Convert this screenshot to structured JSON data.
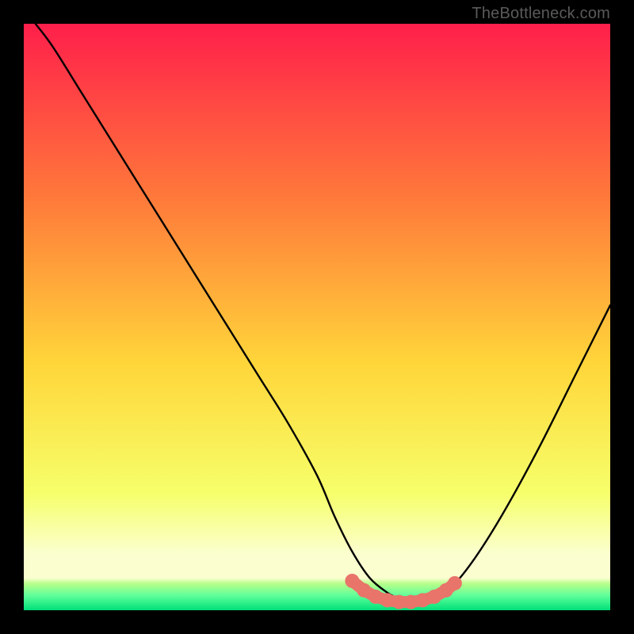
{
  "watermark": "TheBottleneck.com",
  "colors": {
    "top": "#ff1f4b",
    "mid_upper": "#ff7a3a",
    "mid": "#ffd63a",
    "mid_lower": "#f6ff6a",
    "band_pale": "#fbffd0",
    "green1": "#b6ff8a",
    "green2": "#5fff9a",
    "green3": "#00e079",
    "curve": "#000000",
    "marker": "#e8746a"
  },
  "chart_data": {
    "type": "line",
    "title": "",
    "xlabel": "",
    "ylabel": "",
    "xlim": [
      0,
      100
    ],
    "ylim": [
      0,
      100
    ],
    "series": [
      {
        "name": "bottleneck-curve",
        "x": [
          2,
          5,
          10,
          15,
          20,
          25,
          30,
          35,
          40,
          45,
          50,
          53,
          56,
          59,
          62,
          64,
          66,
          68,
          70,
          73,
          77,
          82,
          88,
          94,
          100
        ],
        "y": [
          100,
          96,
          88,
          80,
          72,
          64,
          56,
          48,
          40,
          32,
          23,
          16,
          10,
          5.5,
          3,
          2,
          1.5,
          1.5,
          2,
          4,
          9,
          17,
          28,
          40,
          52
        ]
      }
    ],
    "markers": {
      "name": "bottom-cluster",
      "x": [
        56,
        58,
        60,
        62,
        64,
        66,
        68,
        70,
        72,
        73.5
      ],
      "y": [
        5.0,
        3.4,
        2.3,
        1.7,
        1.4,
        1.4,
        1.7,
        2.3,
        3.4,
        4.6
      ]
    }
  }
}
